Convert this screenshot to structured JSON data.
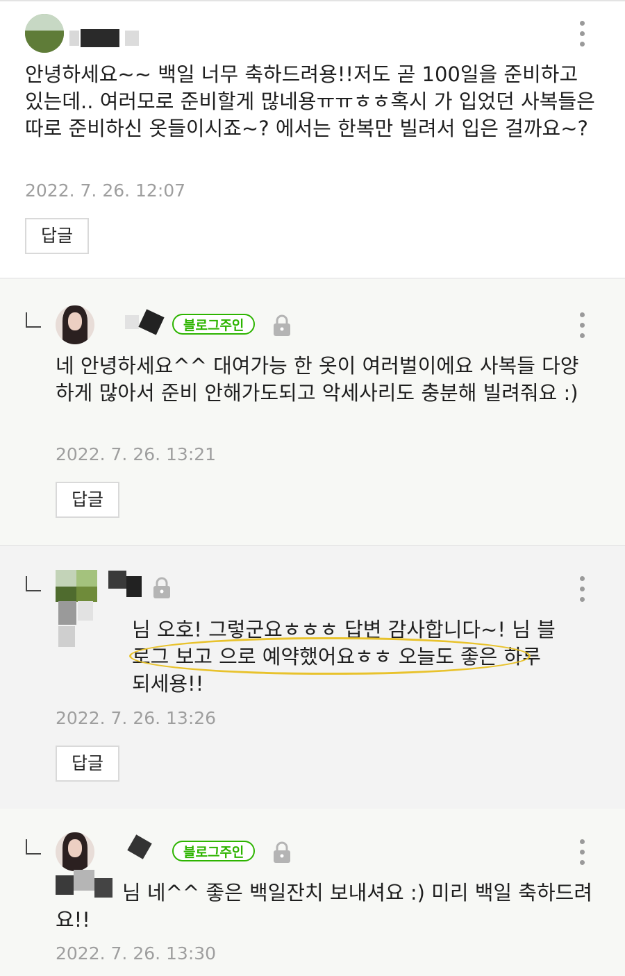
{
  "comments": [
    {
      "text": "안녕하세요~~ 백일 너무 축하드려용!!저도 곧 100일을 준비하고 있는데.. 여러모로 준비할게 많네용ㅠㅠㅎㅎ혹시 가 입었던 사복들은 따로 준비하신 옷들이시죠~? 에서는 한복만 빌려서 입은 걸까요~?",
      "date": "2022. 7. 26. 12:07",
      "reply_label": "답글"
    },
    {
      "badge": "블로그주인",
      "text": "네 안녕하세요^^ 대여가능 한 옷이 여러벌이에요 사복들 다양하게 많아서 준비 안해가도되고 악세사리도 충분해 빌려줘요 :)",
      "date": "2022. 7. 26. 13:21",
      "reply_label": "답글"
    },
    {
      "text": "님 오호! 그렇군요ㅎㅎㅎ 답변 감사합니다~! 님 블로그 보고 으로 예약했어요ㅎㅎ 오늘도 좋은 하루 되세용!!",
      "date": "2022. 7. 26. 13:26",
      "reply_label": "답글"
    },
    {
      "badge": "블로그주인",
      "text": "님 네^^ 좋은 백일잔치 보내셔요 :) 미리 백일 축하드려요!!",
      "date": "2022. 7. 26. 13:30"
    }
  ],
  "colors": {
    "badge_green": "#2db400",
    "highlight": "#e8c22c",
    "date_gray": "#9e9e9e"
  },
  "icons": {
    "more": "more-vertical-icon",
    "lock": "lock-icon",
    "reply": "reply-arrow-icon"
  }
}
